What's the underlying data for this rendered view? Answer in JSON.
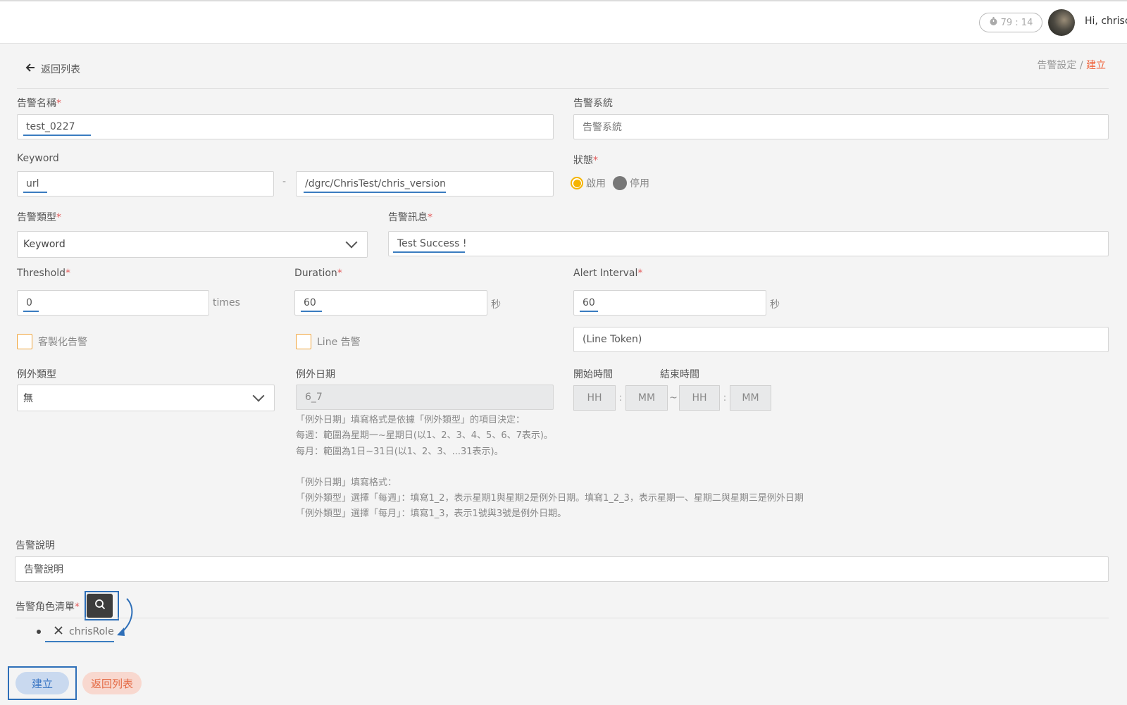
{
  "header": {
    "timer": "79 : 14",
    "greeting": "Hi, chrisc"
  },
  "nav": {
    "back_label": "返回列表",
    "breadcrumb_parent": "告警設定",
    "breadcrumb_sep": " / ",
    "breadcrumb_current": "建立"
  },
  "form": {
    "name": {
      "label": "告警名稱",
      "value": "test_0227"
    },
    "system": {
      "label": "告警系統",
      "placeholder": "告警系統"
    },
    "keyword": {
      "label": "Keyword",
      "value1": "url",
      "separator": "-",
      "value2": "/dgrc/ChrisTest/chris_version"
    },
    "status": {
      "label": "狀態",
      "option_on": "啟用",
      "option_off": "停用",
      "selected": "啟用"
    },
    "type": {
      "label": "告警類型",
      "value": "Keyword"
    },
    "message": {
      "label": "告警訊息",
      "value": "Test Success !"
    },
    "threshold": {
      "label": "Threshold",
      "value": "0",
      "unit": "times"
    },
    "duration": {
      "label": "Duration",
      "value": "60",
      "unit": "秒"
    },
    "alert_interval": {
      "label": "Alert Interval",
      "value": "60",
      "unit": "秒"
    },
    "custom_alert": {
      "label": "客製化告警",
      "checked": false
    },
    "line_alert": {
      "label": "Line 告警",
      "checked": false
    },
    "line_token": {
      "placeholder": "(Line Token)"
    },
    "exception_type": {
      "label": "例外類型",
      "value": "無"
    },
    "exception_date": {
      "label": "例外日期",
      "value": "6_7"
    },
    "start_time": {
      "label": "開始時間",
      "hh": "HH",
      "mm": "MM"
    },
    "end_time": {
      "label": "結束時間",
      "hh": "HH",
      "mm": "MM"
    },
    "time_colon": ":",
    "time_tilde": "~",
    "help": {
      "line1": "「例外日期」填寫格式是依據「例外類型」的項目決定：",
      "line2": "每週：範圍為星期一~星期日(以1、2、3、4、5、6、7表示)。",
      "line3": "每月：範圍為1日~31日(以1、2、3、...31表示)。",
      "line4": "「例外日期」填寫格式：",
      "line5": "「例外類型」選擇「每週」：填寫1_2，表示星期1與星期2是例外日期。填寫1_2_3，表示星期一、星期二與星期三是例外日期",
      "line6": "「例外類型」選擇「每月」：填寫1_3，表示1號與3號是例外日期。"
    },
    "description": {
      "label": "告警說明",
      "placeholder": "告警說明"
    },
    "roles": {
      "label": "告警角色清單",
      "items": [
        "chrisRole"
      ]
    }
  },
  "actions": {
    "create_label": "建立",
    "back_label": "返回列表"
  },
  "colors": {
    "accent_orange": "#f0643c",
    "annotation_blue": "#2e6fb8",
    "radio_yellow": "#f5b400"
  }
}
